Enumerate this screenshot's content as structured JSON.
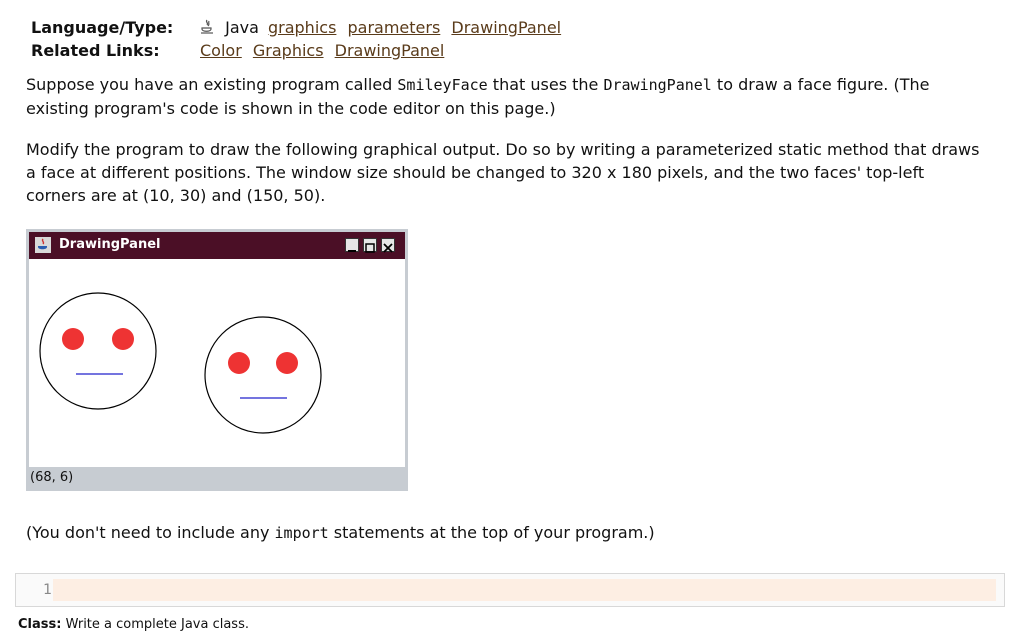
{
  "meta": {
    "language_label": "Language/Type:",
    "language_value": "Java",
    "language_links": [
      "graphics",
      "parameters",
      "DrawingPanel"
    ],
    "related_label": "Related Links:",
    "related_links": [
      "Color",
      "Graphics",
      "DrawingPanel"
    ]
  },
  "para1": {
    "a": "Suppose you have an existing program called ",
    "code1": "SmileyFace",
    "b": " that uses the ",
    "code2": "DrawingPanel",
    "c": " to draw a face figure. (The existing program's code is shown in the code editor on this page.)"
  },
  "para2": "Modify the program to draw the following graphical output. Do so by writing a parameterized static method that draws a face at different positions. The window size should be changed to 320 x 180 pixels, and the two faces' top-left corners are at (10, 30) and (150, 50).",
  "window": {
    "title": "DrawingPanel",
    "status": "(68, 6)",
    "colors": {
      "titlebar": "#4b0f26",
      "eyes": "#ee3333",
      "mouth": "#2222cc",
      "outline": "#000000"
    }
  },
  "note": {
    "a": "(You don't need to include any ",
    "code": "import",
    "b": " statements at the top of your program.)"
  },
  "editor": {
    "line_number": "1",
    "content": ""
  },
  "footer": {
    "label": "Class:",
    "text": " Write a complete Java class."
  }
}
